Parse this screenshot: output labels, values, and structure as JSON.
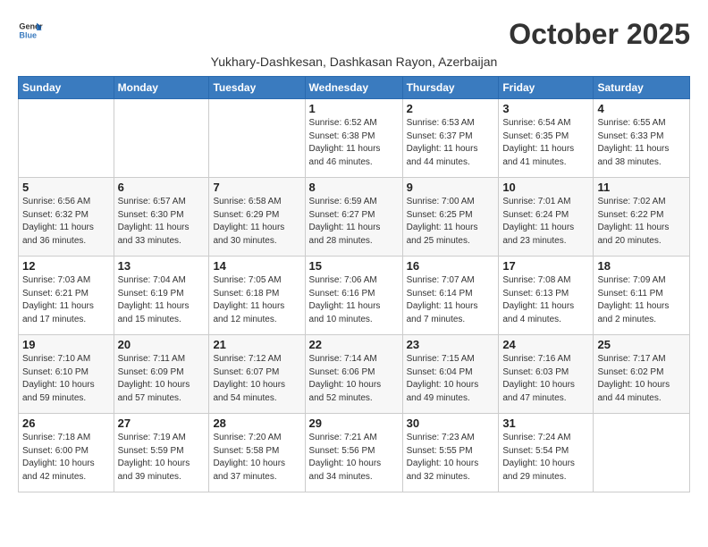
{
  "header": {
    "logo_general": "General",
    "logo_blue": "Blue",
    "month_title": "October 2025",
    "subtitle": "Yukhary-Dashkesan, Dashkasan Rayon, Azerbaijan"
  },
  "weekdays": [
    "Sunday",
    "Monday",
    "Tuesday",
    "Wednesday",
    "Thursday",
    "Friday",
    "Saturday"
  ],
  "weeks": [
    [
      {
        "day": "",
        "info": ""
      },
      {
        "day": "",
        "info": ""
      },
      {
        "day": "",
        "info": ""
      },
      {
        "day": "1",
        "info": "Sunrise: 6:52 AM\nSunset: 6:38 PM\nDaylight: 11 hours\nand 46 minutes."
      },
      {
        "day": "2",
        "info": "Sunrise: 6:53 AM\nSunset: 6:37 PM\nDaylight: 11 hours\nand 44 minutes."
      },
      {
        "day": "3",
        "info": "Sunrise: 6:54 AM\nSunset: 6:35 PM\nDaylight: 11 hours\nand 41 minutes."
      },
      {
        "day": "4",
        "info": "Sunrise: 6:55 AM\nSunset: 6:33 PM\nDaylight: 11 hours\nand 38 minutes."
      }
    ],
    [
      {
        "day": "5",
        "info": "Sunrise: 6:56 AM\nSunset: 6:32 PM\nDaylight: 11 hours\nand 36 minutes."
      },
      {
        "day": "6",
        "info": "Sunrise: 6:57 AM\nSunset: 6:30 PM\nDaylight: 11 hours\nand 33 minutes."
      },
      {
        "day": "7",
        "info": "Sunrise: 6:58 AM\nSunset: 6:29 PM\nDaylight: 11 hours\nand 30 minutes."
      },
      {
        "day": "8",
        "info": "Sunrise: 6:59 AM\nSunset: 6:27 PM\nDaylight: 11 hours\nand 28 minutes."
      },
      {
        "day": "9",
        "info": "Sunrise: 7:00 AM\nSunset: 6:25 PM\nDaylight: 11 hours\nand 25 minutes."
      },
      {
        "day": "10",
        "info": "Sunrise: 7:01 AM\nSunset: 6:24 PM\nDaylight: 11 hours\nand 23 minutes."
      },
      {
        "day": "11",
        "info": "Sunrise: 7:02 AM\nSunset: 6:22 PM\nDaylight: 11 hours\nand 20 minutes."
      }
    ],
    [
      {
        "day": "12",
        "info": "Sunrise: 7:03 AM\nSunset: 6:21 PM\nDaylight: 11 hours\nand 17 minutes."
      },
      {
        "day": "13",
        "info": "Sunrise: 7:04 AM\nSunset: 6:19 PM\nDaylight: 11 hours\nand 15 minutes."
      },
      {
        "day": "14",
        "info": "Sunrise: 7:05 AM\nSunset: 6:18 PM\nDaylight: 11 hours\nand 12 minutes."
      },
      {
        "day": "15",
        "info": "Sunrise: 7:06 AM\nSunset: 6:16 PM\nDaylight: 11 hours\nand 10 minutes."
      },
      {
        "day": "16",
        "info": "Sunrise: 7:07 AM\nSunset: 6:14 PM\nDaylight: 11 hours\nand 7 minutes."
      },
      {
        "day": "17",
        "info": "Sunrise: 7:08 AM\nSunset: 6:13 PM\nDaylight: 11 hours\nand 4 minutes."
      },
      {
        "day": "18",
        "info": "Sunrise: 7:09 AM\nSunset: 6:11 PM\nDaylight: 11 hours\nand 2 minutes."
      }
    ],
    [
      {
        "day": "19",
        "info": "Sunrise: 7:10 AM\nSunset: 6:10 PM\nDaylight: 10 hours\nand 59 minutes."
      },
      {
        "day": "20",
        "info": "Sunrise: 7:11 AM\nSunset: 6:09 PM\nDaylight: 10 hours\nand 57 minutes."
      },
      {
        "day": "21",
        "info": "Sunrise: 7:12 AM\nSunset: 6:07 PM\nDaylight: 10 hours\nand 54 minutes."
      },
      {
        "day": "22",
        "info": "Sunrise: 7:14 AM\nSunset: 6:06 PM\nDaylight: 10 hours\nand 52 minutes."
      },
      {
        "day": "23",
        "info": "Sunrise: 7:15 AM\nSunset: 6:04 PM\nDaylight: 10 hours\nand 49 minutes."
      },
      {
        "day": "24",
        "info": "Sunrise: 7:16 AM\nSunset: 6:03 PM\nDaylight: 10 hours\nand 47 minutes."
      },
      {
        "day": "25",
        "info": "Sunrise: 7:17 AM\nSunset: 6:02 PM\nDaylight: 10 hours\nand 44 minutes."
      }
    ],
    [
      {
        "day": "26",
        "info": "Sunrise: 7:18 AM\nSunset: 6:00 PM\nDaylight: 10 hours\nand 42 minutes."
      },
      {
        "day": "27",
        "info": "Sunrise: 7:19 AM\nSunset: 5:59 PM\nDaylight: 10 hours\nand 39 minutes."
      },
      {
        "day": "28",
        "info": "Sunrise: 7:20 AM\nSunset: 5:58 PM\nDaylight: 10 hours\nand 37 minutes."
      },
      {
        "day": "29",
        "info": "Sunrise: 7:21 AM\nSunset: 5:56 PM\nDaylight: 10 hours\nand 34 minutes."
      },
      {
        "day": "30",
        "info": "Sunrise: 7:23 AM\nSunset: 5:55 PM\nDaylight: 10 hours\nand 32 minutes."
      },
      {
        "day": "31",
        "info": "Sunrise: 7:24 AM\nSunset: 5:54 PM\nDaylight: 10 hours\nand 29 minutes."
      },
      {
        "day": "",
        "info": ""
      }
    ]
  ]
}
